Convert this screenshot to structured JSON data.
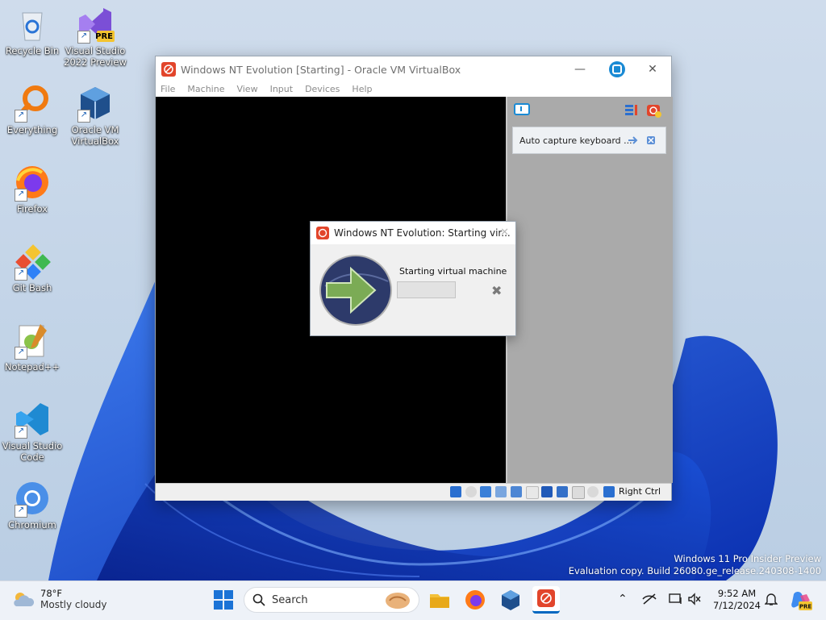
{
  "desktop": {
    "icons": [
      {
        "label": "Recycle Bin",
        "icon": "recycle-bin-icon"
      },
      {
        "label": "Visual Studio 2022 Preview",
        "icon": "visual-studio-icon",
        "badge": "PRE"
      },
      {
        "label": "Everything",
        "icon": "everything-search-icon"
      },
      {
        "label": "Oracle VM VirtualBox",
        "icon": "virtualbox-icon"
      },
      {
        "label": "Firefox",
        "icon": "firefox-icon"
      },
      {
        "label": "Git Bash",
        "icon": "git-bash-icon"
      },
      {
        "label": "Notepad++",
        "icon": "notepad-plus-plus-icon"
      },
      {
        "label": "Visual Studio Code",
        "icon": "vscode-icon"
      },
      {
        "label": "Chromium",
        "icon": "chromium-icon"
      }
    ],
    "watermark": {
      "line1": "Windows 11 Pro Insider Preview",
      "line2": "Evaluation copy. Build 26080.ge_release.240308-1400"
    }
  },
  "vbox_window": {
    "title": "Windows NT Evolution [Starting] - Oracle VM VirtualBox",
    "menu": [
      "File",
      "Machine",
      "View",
      "Input",
      "Devices",
      "Help"
    ],
    "notice_text": "Auto capture keyboard ...",
    "host_key": "Right Ctrl",
    "brand_color": "#e2452b"
  },
  "dialog": {
    "title": "Windows NT Evolution: Starting vir...",
    "message": "Starting virtual machine ...",
    "progress": 0
  },
  "taskbar": {
    "weather_temp": "78°F",
    "weather_condition": "Mostly cloudy",
    "search_placeholder": "Search",
    "time": "9:52 AM",
    "date": "7/12/2024",
    "accent": "#0067c0"
  }
}
